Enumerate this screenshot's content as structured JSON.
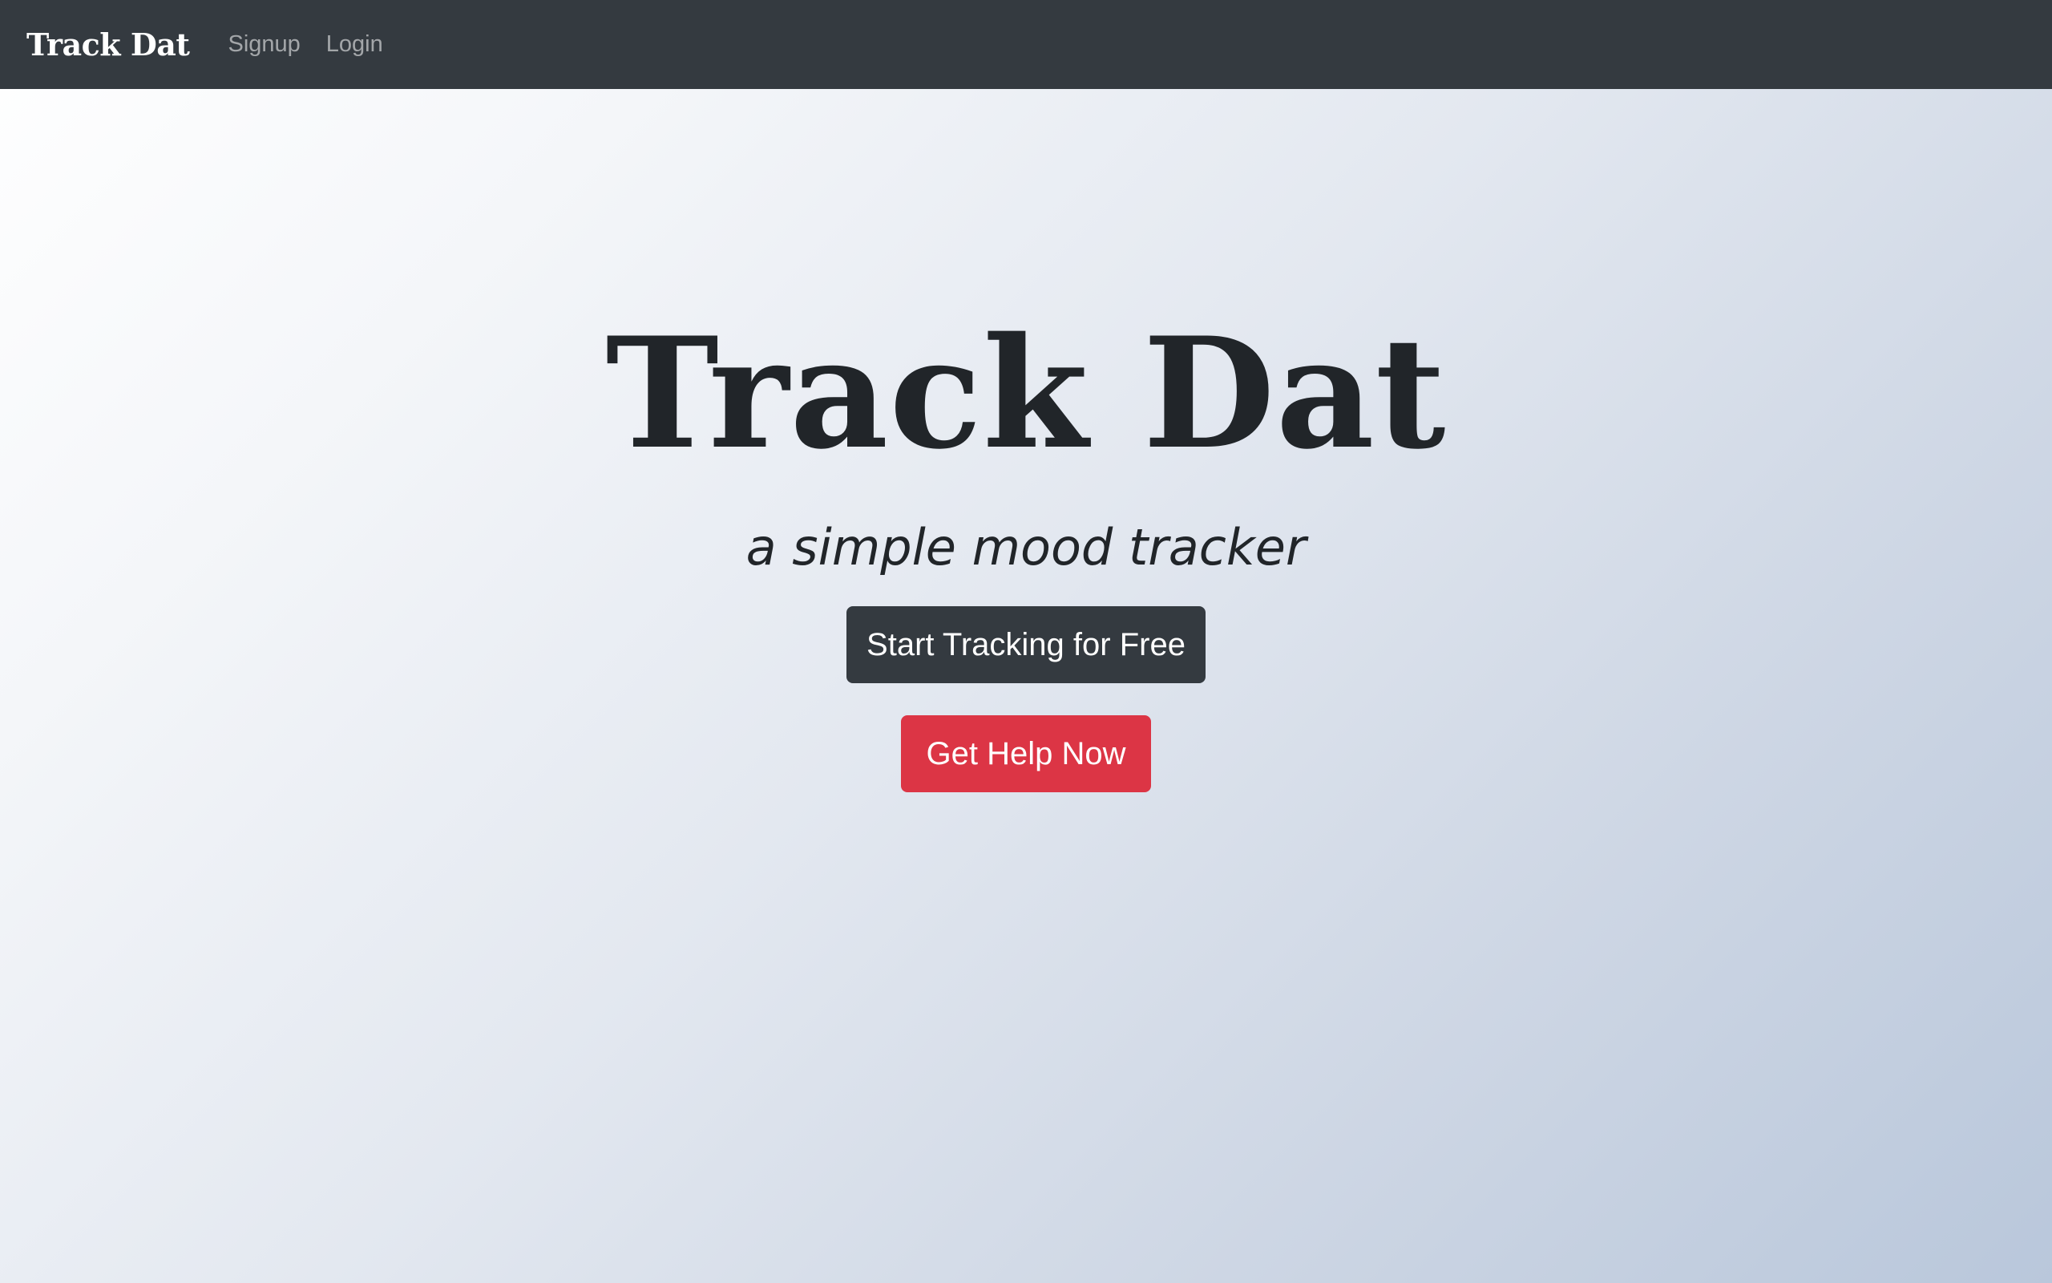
{
  "navbar": {
    "brand": "Track Dat",
    "links": [
      {
        "label": "Signup"
      },
      {
        "label": "Login"
      }
    ]
  },
  "hero": {
    "title": "Track Dat",
    "subtitle": "a simple mood tracker",
    "primary_button": "Start Tracking for Free",
    "help_button": "Get Help Now"
  },
  "colors": {
    "navbar_bg": "#343a40",
    "text_dark": "#212529",
    "button_dark": "#343a40",
    "button_danger": "#dc3545"
  }
}
